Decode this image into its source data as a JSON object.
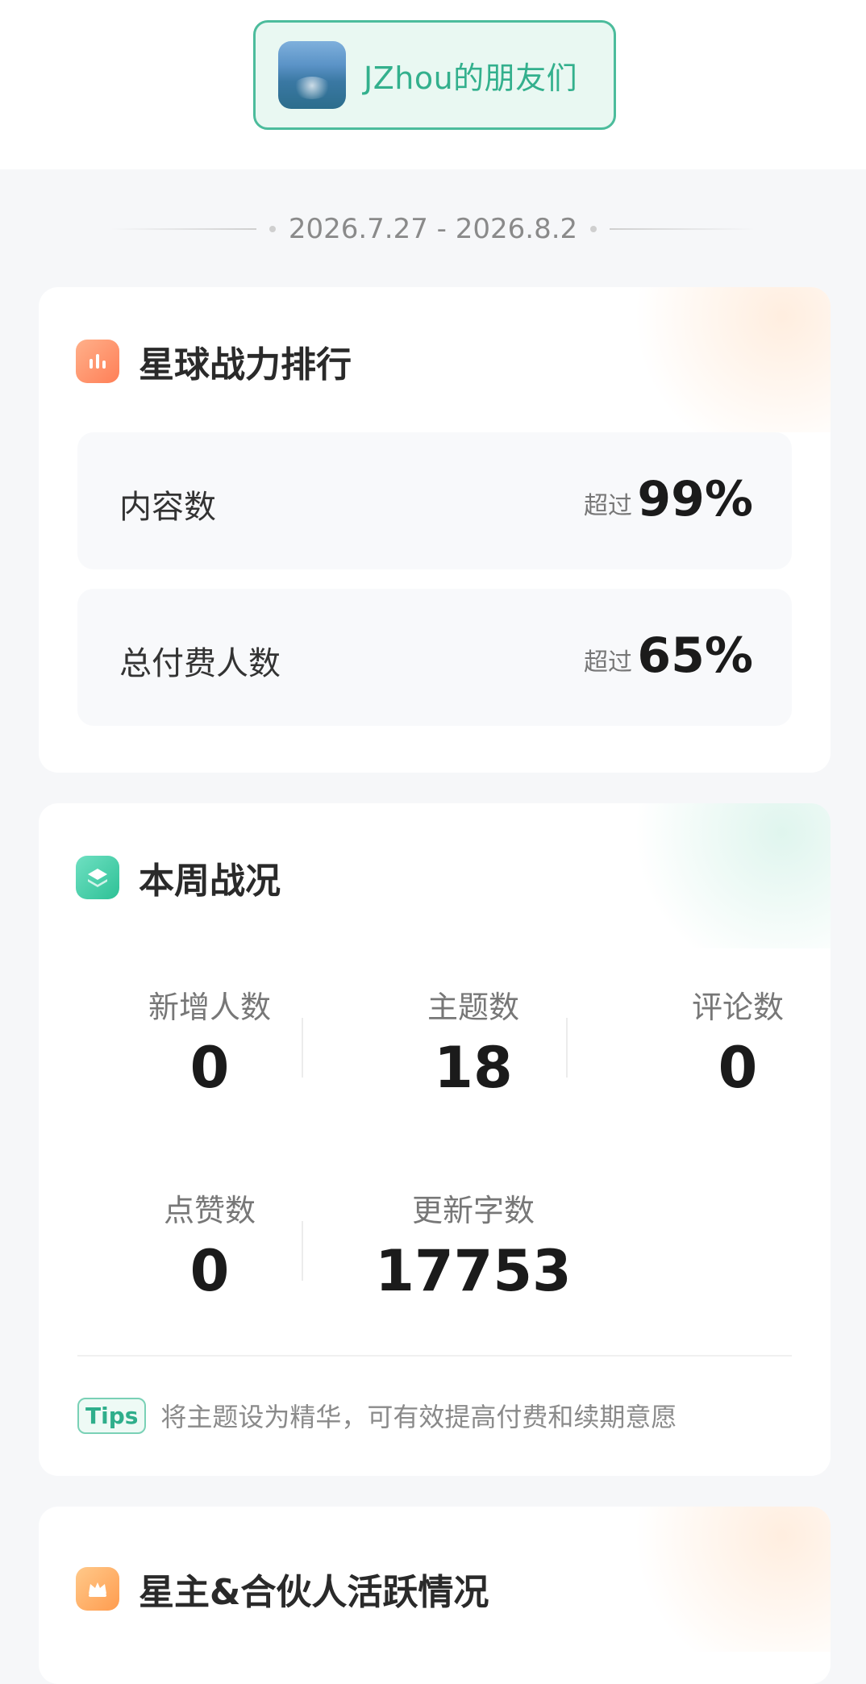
{
  "header": {
    "group_name": "JZhou的朋友们"
  },
  "date_range": "2026.7.27 - 2026.8.2",
  "ranking": {
    "title": "星球战力排行",
    "rows": [
      {
        "label": "内容数",
        "prefix": "超过",
        "value": "99%"
      },
      {
        "label": "总付费人数",
        "prefix": "超过",
        "value": "65%"
      }
    ]
  },
  "weekly": {
    "title": "本周战况",
    "stats": [
      {
        "label": "新增人数",
        "value": "0"
      },
      {
        "label": "主题数",
        "value": "18"
      },
      {
        "label": "评论数",
        "value": "0"
      },
      {
        "label": "点赞数",
        "value": "0"
      },
      {
        "label": "更新字数",
        "value": "17753"
      }
    ],
    "tips_badge": "Tips",
    "tips_text": "将主题设为精华，可有效提高付费和续期意愿"
  },
  "activity": {
    "title": "星主&合伙人活跃情况"
  },
  "colors": {
    "accent_green": "#33b08d",
    "orange_icon": "#ff7f57",
    "green_icon": "#2ec196",
    "yellow_icon": "#ff9c4f"
  },
  "icons": {
    "ranking": "bar-chart-icon",
    "weekly": "layers-icon",
    "activity": "crown-icon"
  }
}
